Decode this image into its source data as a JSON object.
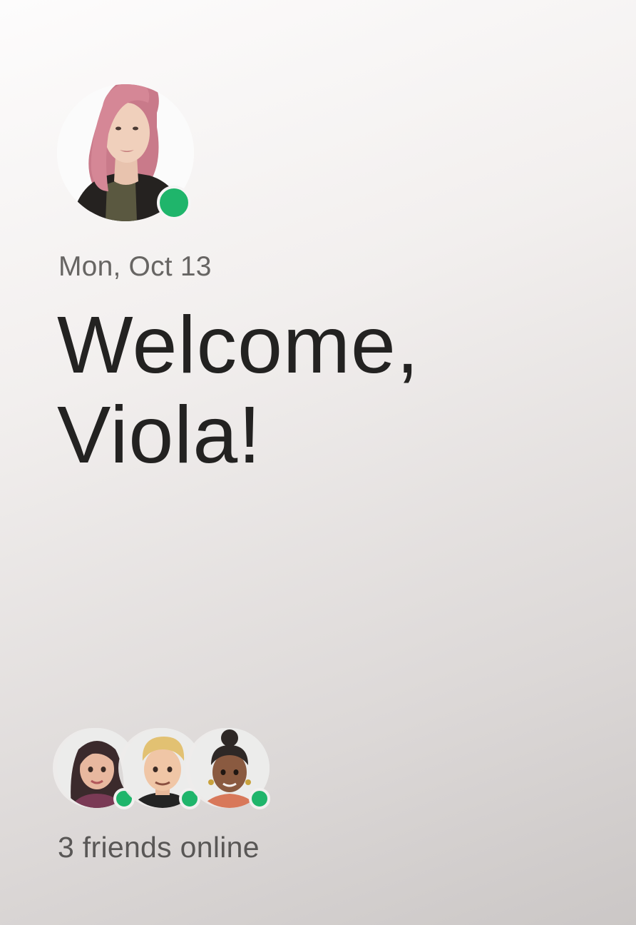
{
  "profile": {
    "avatar_icon": "user-profile-photo",
    "status": "online",
    "status_color": "#1fb56b"
  },
  "header": {
    "date": "Mon, Oct 13",
    "welcome_line1": "Welcome,",
    "welcome_line2": "Viola!"
  },
  "friends": {
    "avatars": [
      {
        "icon": "friend-avatar-woman-dark-hair",
        "status": "online"
      },
      {
        "icon": "friend-avatar-man-blond-hair",
        "status": "online"
      },
      {
        "icon": "friend-avatar-woman-updo",
        "status": "online"
      }
    ],
    "online_label": "3 friends online"
  }
}
